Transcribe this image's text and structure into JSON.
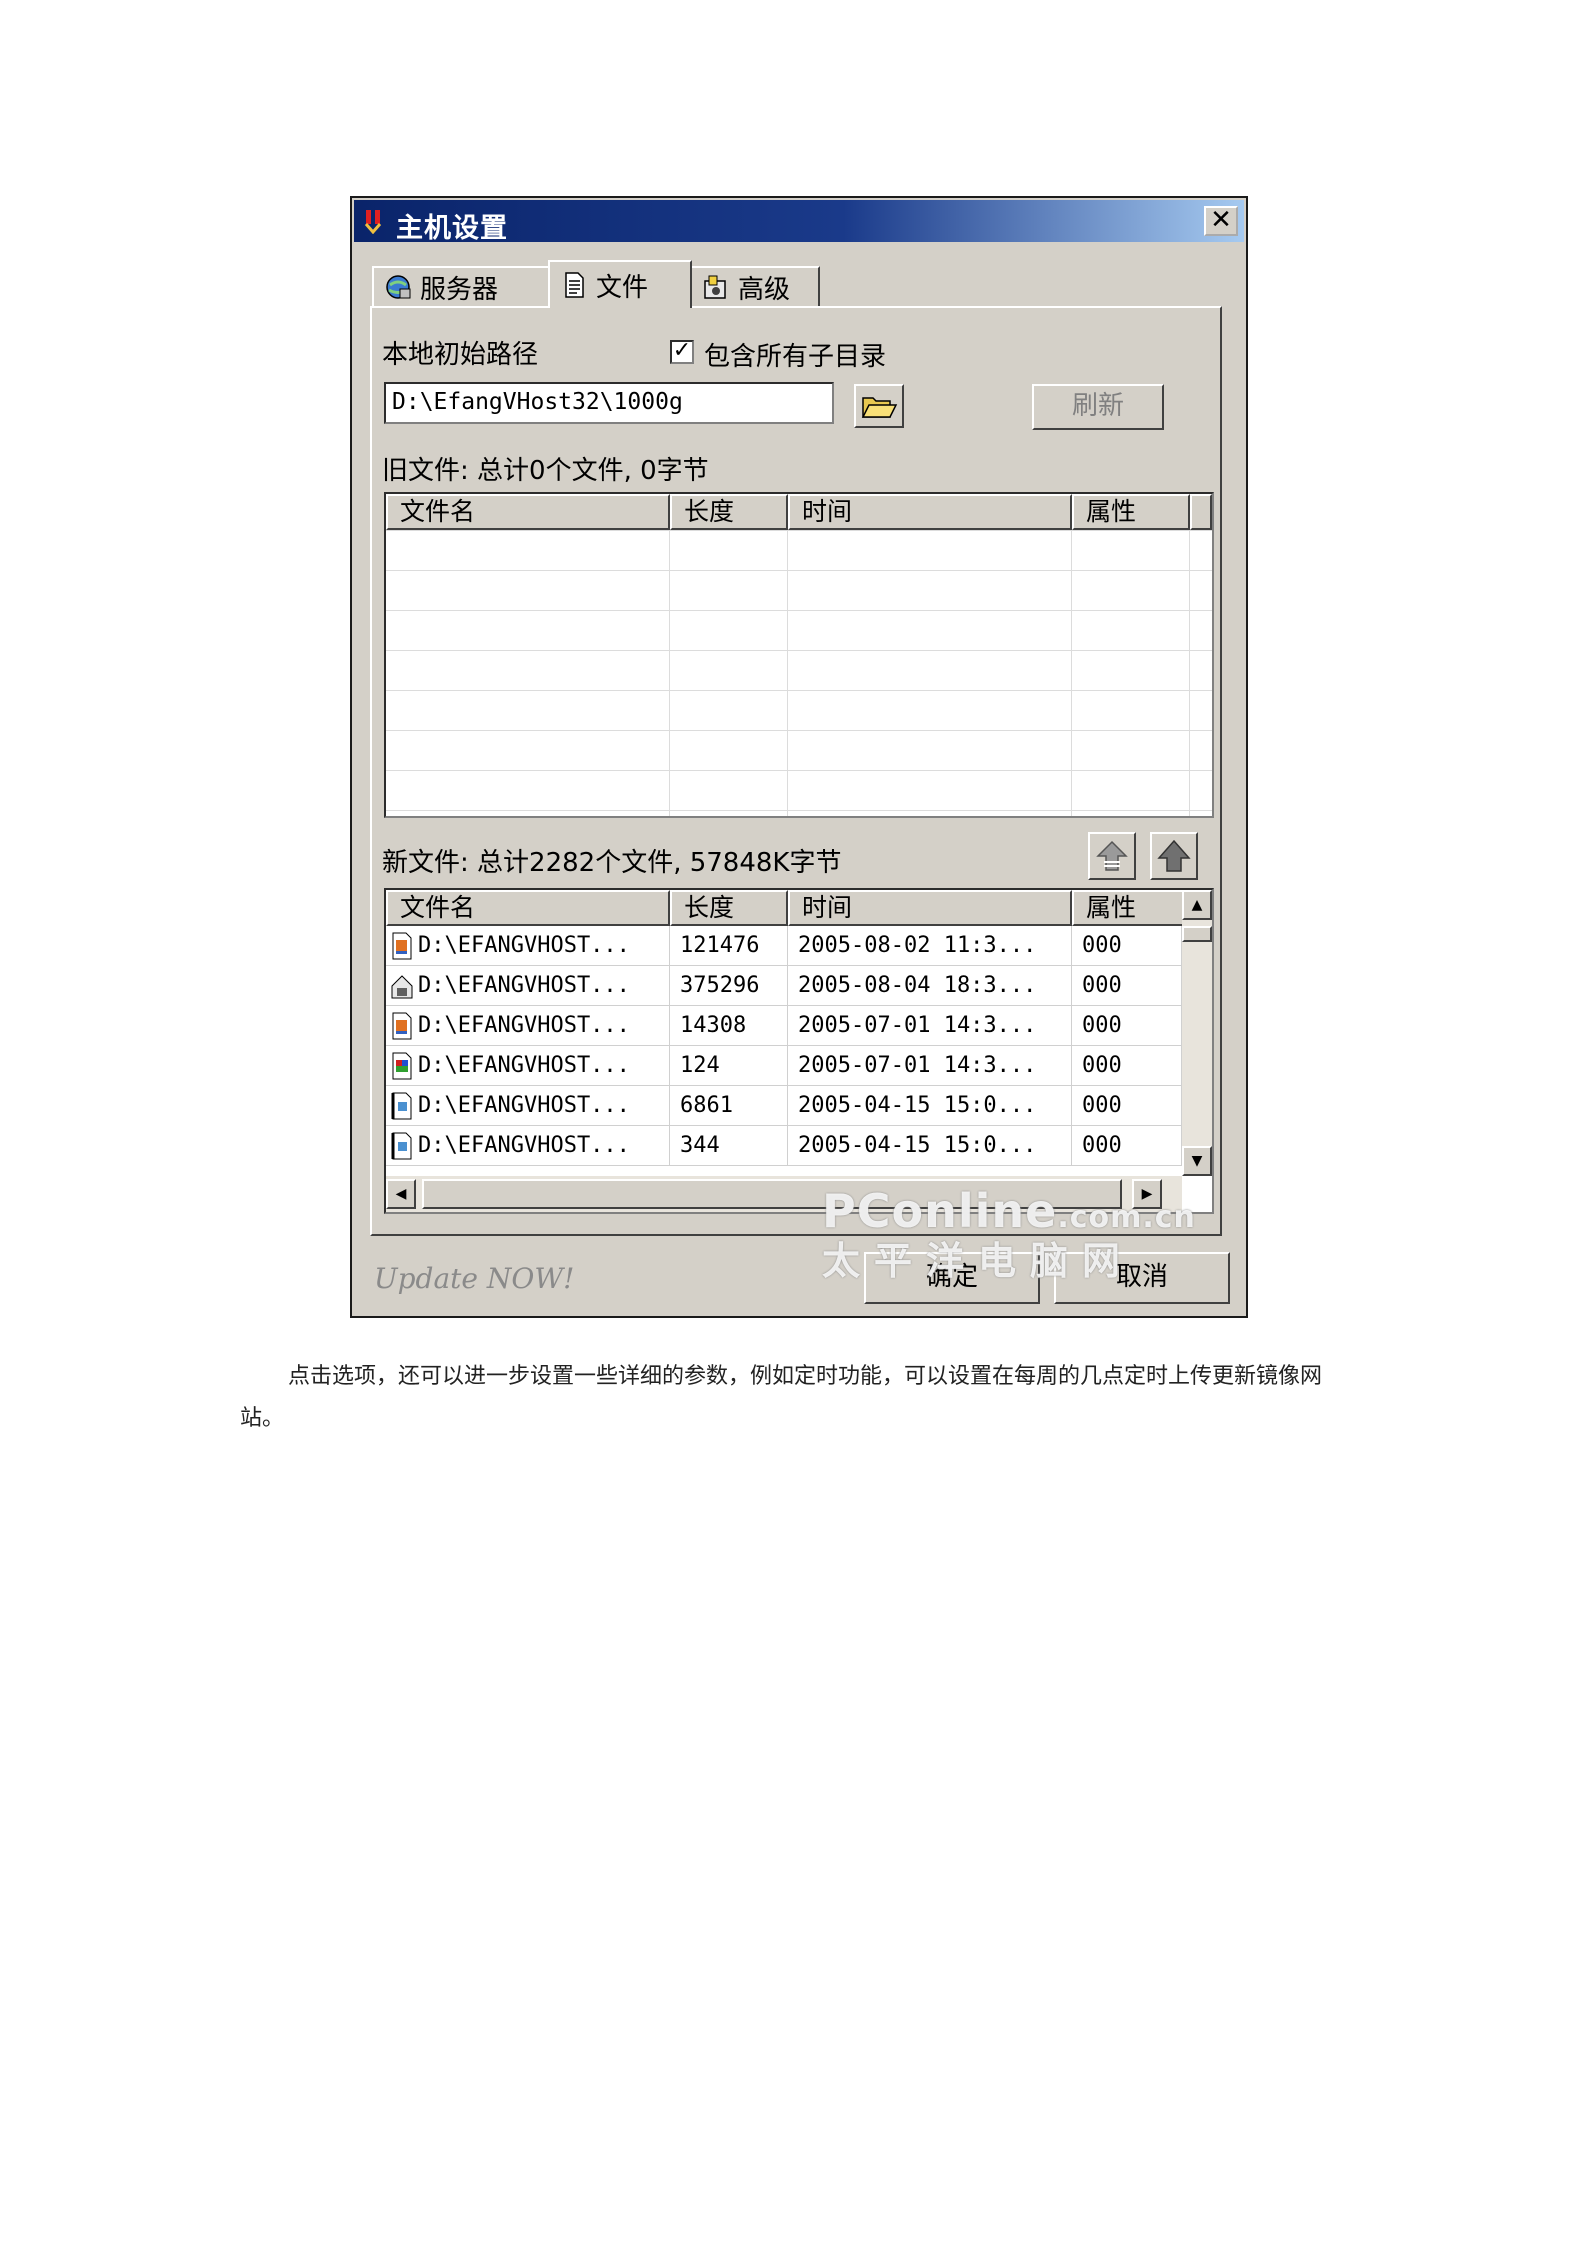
{
  "dialog": {
    "title": "主机设置",
    "close_label": "✕",
    "tabs": [
      {
        "label": "服务器",
        "icon": "server-icon"
      },
      {
        "label": "文件",
        "icon": "document-icon"
      },
      {
        "label": "高级",
        "icon": "advanced-icon"
      }
    ],
    "local_path_label": "本地初始路径",
    "include_subdirs_label": "包含所有子目录",
    "include_subdirs_checked": true,
    "path_value": "D:\\EfangVHost32\\1000g",
    "refresh_label": "刷新",
    "old_files_label": "旧文件: 总计0个文件, 0字节",
    "new_files_label": "新文件: 总计2282个文件, 57848K字节",
    "columns": [
      "文件名",
      "长度",
      "时间",
      "属性"
    ],
    "new_files": [
      {
        "name": "D:\\EFANGVHOST...",
        "size": "121476",
        "time": "2005-08-02 11:3...",
        "attr": "000",
        "icon": "html-file-icon"
      },
      {
        "name": "D:\\EFANGVHOST...",
        "size": "375296",
        "time": "2005-08-04 18:3...",
        "attr": "000",
        "icon": "program-file-icon"
      },
      {
        "name": "D:\\EFANGVHOST...",
        "size": "14308",
        "time": "2005-07-01 14:3...",
        "attr": "000",
        "icon": "html-file-icon"
      },
      {
        "name": "D:\\EFANGVHOST...",
        "size": "124",
        "time": "2005-07-01 14:3...",
        "attr": "000",
        "icon": "image-file-icon"
      },
      {
        "name": "D:\\EFANGVHOST...",
        "size": "6861",
        "time": "2005-04-15 15:0...",
        "attr": "000",
        "icon": "text-file-icon"
      },
      {
        "name": "D:\\EFANGVHOST...",
        "size": "344",
        "time": "2005-04-15 15:0...",
        "attr": "000",
        "icon": "text-file-icon"
      }
    ],
    "update_label": "Update NOW!",
    "ok_label": "确定",
    "cancel_label": "取消"
  },
  "watermark": {
    "line1": "PConline",
    "line1_suffix": ".com.cn",
    "line2": "太平洋电脑网"
  },
  "paragraph": "点击选项，还可以进一步设置一些详细的参数，例如定时功能，可以设置在每周的几点定时上传更新镜像网站。"
}
